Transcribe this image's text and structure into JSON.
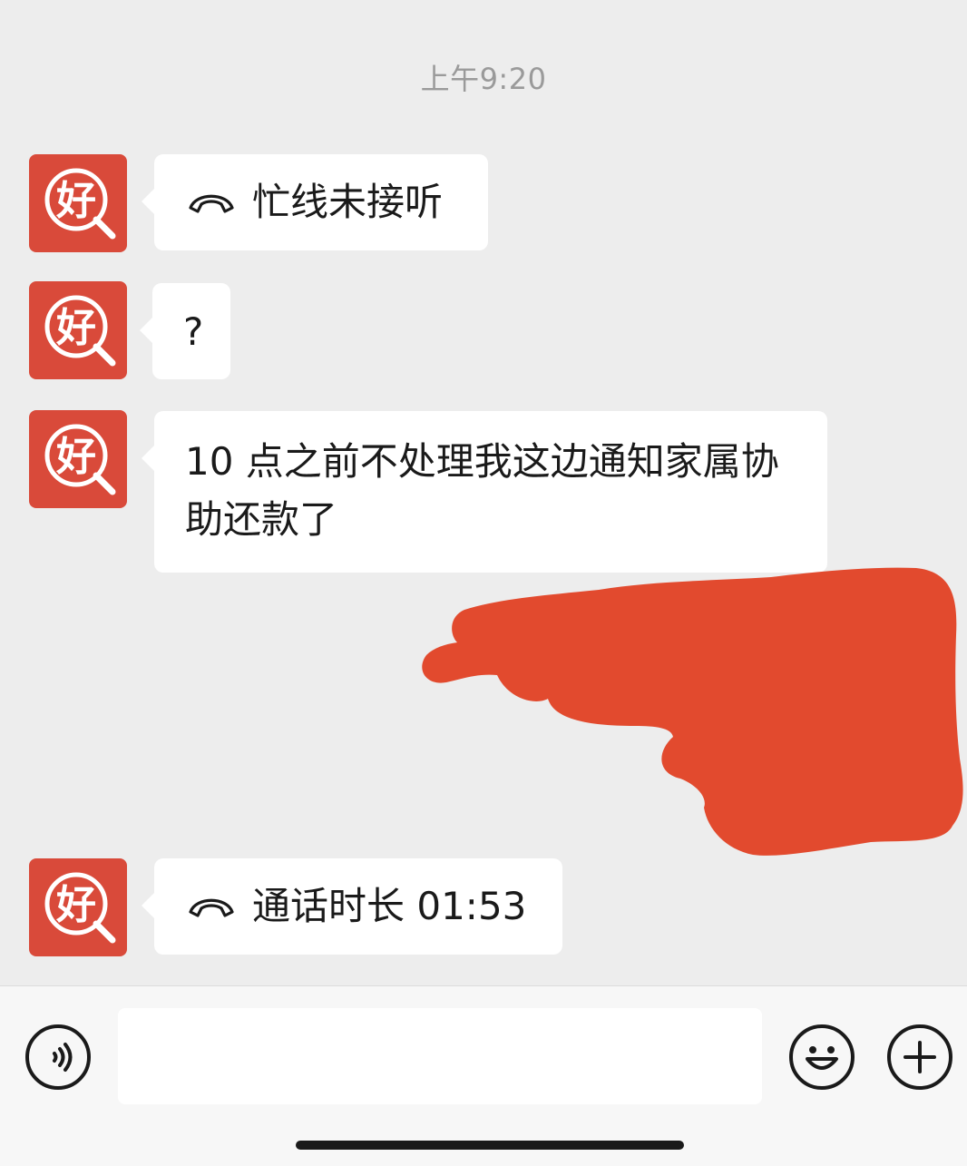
{
  "chat": {
    "timestamp": "上午9:20",
    "avatar_text": "好",
    "messages": [
      {
        "type": "call",
        "text": "忙线未接听"
      },
      {
        "type": "text",
        "text": "?"
      },
      {
        "type": "text",
        "lines": [
          "10 点之前不处理我这边通知家属协",
          "助还款了"
        ]
      },
      {
        "type": "call",
        "text": "通话时长 01:53"
      }
    ]
  },
  "input_bar": {
    "placeholder": ""
  },
  "colors": {
    "avatar": "#d94a3a",
    "redaction": "#e24a2e",
    "background": "#ededed"
  },
  "icons": [
    "phone-hangup-icon",
    "voice-icon",
    "emoji-icon",
    "plus-icon"
  ]
}
